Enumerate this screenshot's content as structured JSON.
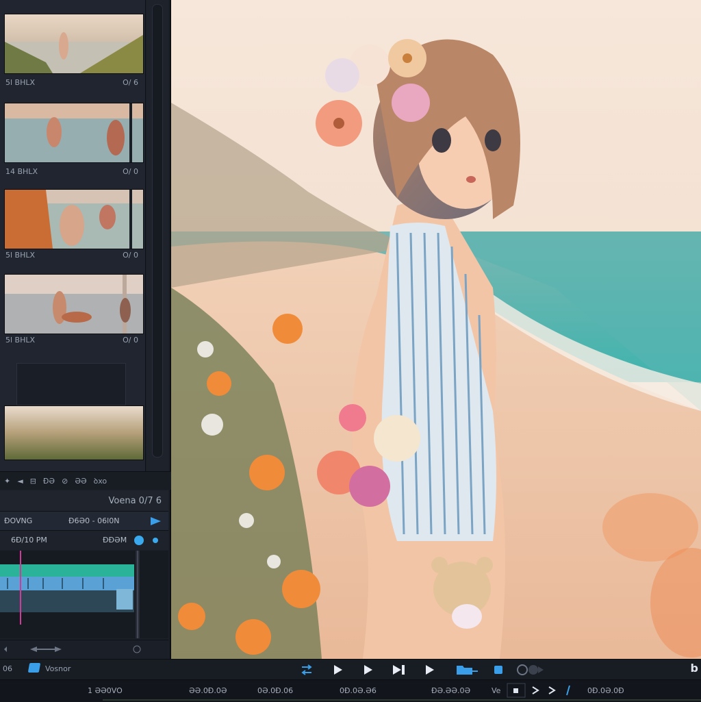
{
  "media_bin": {
    "clips": [
      {
        "name": "5l BHLX",
        "duration": "O/ 6"
      },
      {
        "name": "14 BHLX",
        "duration": "O/ 0"
      },
      {
        "name": "5l BHLX",
        "duration": "O/ 0"
      },
      {
        "name": "5l BHLX",
        "duration": "O/ 0"
      }
    ],
    "toolbar": [
      "✦",
      "◄",
      "⊟",
      "ĐƏ",
      "⊘",
      "ƏƏ",
      "ꝺxo"
    ]
  },
  "timeline": {
    "title": "Voena 0/7 6",
    "row1_left": "ĐOVNG",
    "row1_mid": "Đ6Ə0 - 06l0N",
    "row2_left": "6Đ/10 PM",
    "row2_mid": "ĐĐƏM"
  },
  "transport": {
    "left_label": "06",
    "clip_label": "Vosnor",
    "right_letter": "b"
  },
  "ruler": {
    "labels": [
      "1 ƏƏ0VO",
      "ƏƏ.0Đ.0Ə",
      "0Ə.0Đ.06",
      "0Đ.0Ə.Ə6",
      "ĐƏ.ƏƏ.0Ə",
      "Ve",
      "0Đ.0Ə.0Đ"
    ]
  },
  "colors": {
    "accent": "#3a9ee8",
    "track_teal": "#2bb39a",
    "track_blue": "#5aa2d6",
    "panel": "#202530"
  }
}
